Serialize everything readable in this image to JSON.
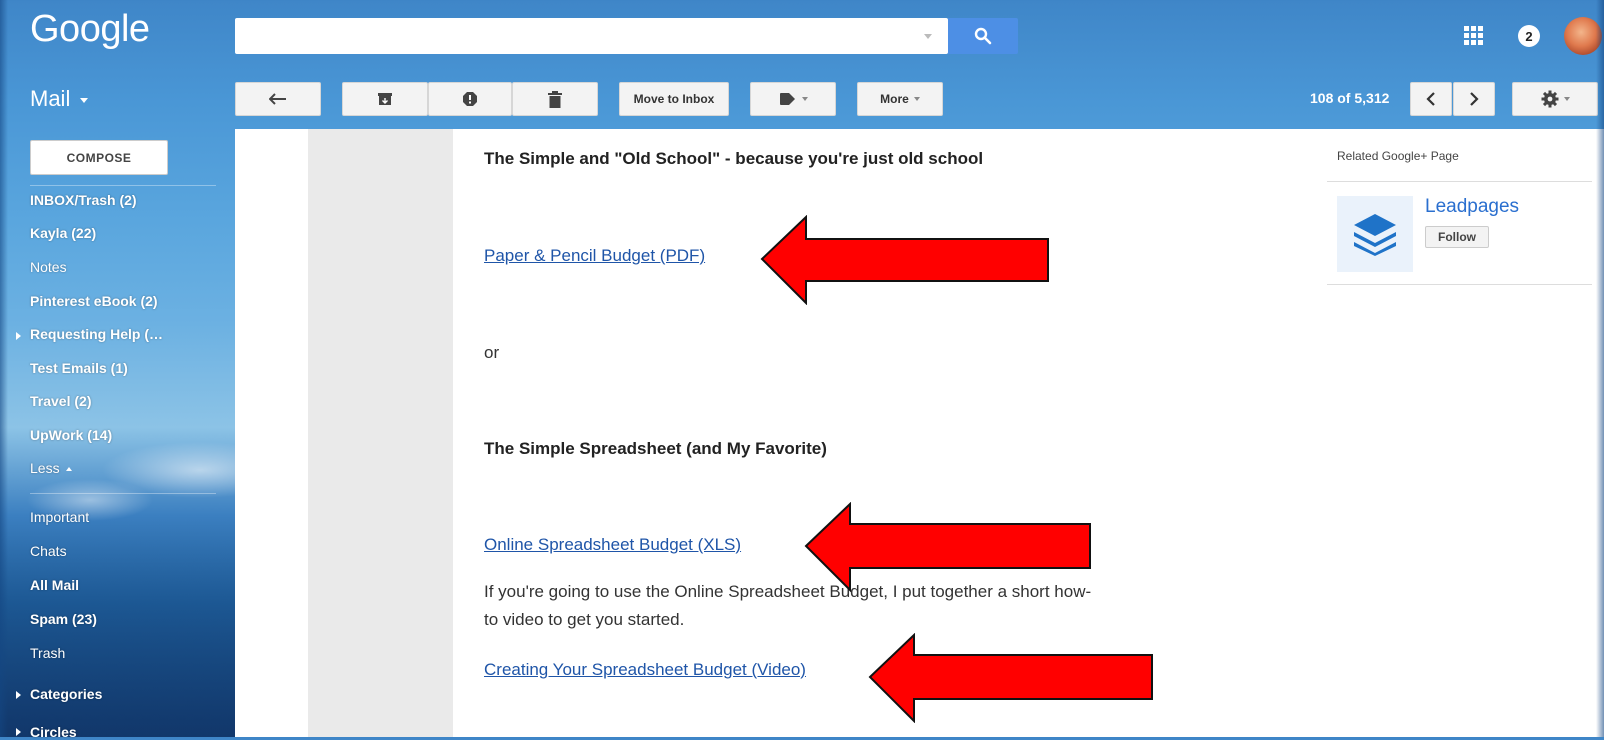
{
  "topbar": {
    "logo": "Google",
    "search_placeholder": "",
    "notification_count": "2"
  },
  "toolbar": {
    "mail_label": "Mail",
    "move_to_inbox": "Move to Inbox",
    "more": "More",
    "count": "108 of 5,312"
  },
  "sidebar": {
    "compose": "COMPOSE",
    "items": [
      {
        "label": "INBOX/Trash (2)",
        "bold": true
      },
      {
        "label": "Kayla (22)",
        "bold": true
      },
      {
        "label": "Notes",
        "bold": false
      },
      {
        "label": "Pinterest eBook (2)",
        "bold": true
      },
      {
        "label": "Requesting Help (…",
        "bold": true
      },
      {
        "label": "Test Emails (1)",
        "bold": true
      },
      {
        "label": "Travel (2)",
        "bold": true
      },
      {
        "label": "UpWork (14)",
        "bold": true
      },
      {
        "label": "Less",
        "bold": false
      },
      {
        "label": "Important",
        "bold": false
      },
      {
        "label": "Chats",
        "bold": false
      },
      {
        "label": "All Mail",
        "bold": true
      },
      {
        "label": "Spam (23)",
        "bold": true
      },
      {
        "label": "Trash",
        "bold": false
      },
      {
        "label": "Categories",
        "bold": true
      },
      {
        "label": "Circles",
        "bold": true
      }
    ]
  },
  "email": {
    "heading1": "The Simple and \"Old School\" - because you're just old school",
    "link1": "Paper & Pencil Budget (PDF)",
    "or": "or",
    "heading2": "The Simple Spreadsheet (and My Favorite)",
    "link2": "Online Spreadsheet Budget (XLS)",
    "paragraph": "If you're going to use the Online Spreadsheet Budget, I put together a short how-to video to get you started.",
    "link3": "Creating Your Spreadsheet Budget (Video)"
  },
  "right_rail": {
    "title": "Related Google+ Page",
    "page_name": "Leadpages",
    "follow": "Follow"
  },
  "colors": {
    "accent_blue": "#4d8fe5",
    "link": "#1f55a8",
    "arrow_red": "#ff0000"
  }
}
